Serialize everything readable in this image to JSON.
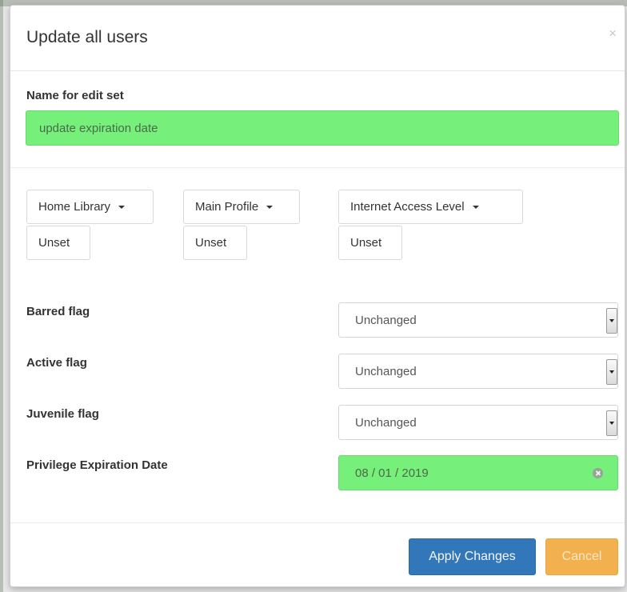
{
  "modal": {
    "title": "Update all users",
    "close_symbol": "×"
  },
  "name_section": {
    "label": "Name for edit set",
    "value": "update expiration date"
  },
  "fields": [
    {
      "label": "Home Library",
      "unset_label": "Unset"
    },
    {
      "label": "Main Profile",
      "unset_label": "Unset"
    },
    {
      "label": "Internet Access Level",
      "unset_label": "Unset"
    }
  ],
  "flags": [
    {
      "label": "Barred flag",
      "value": "Unchanged"
    },
    {
      "label": "Active flag",
      "value": "Unchanged"
    },
    {
      "label": "Juvenile flag",
      "value": "Unchanged"
    }
  ],
  "expiration": {
    "label": "Privilege Expiration Date",
    "value": "08 / 01 / 2019"
  },
  "footer": {
    "apply_label": "Apply Changes",
    "cancel_label": "Cancel"
  },
  "colors": {
    "highlight_green": "#76f07a",
    "primary_blue": "#3377bb",
    "warning_orange": "#f2b04e"
  },
  "icons": {
    "close": "close-icon",
    "caret": "caret-down-icon",
    "clear": "clear-icon"
  }
}
